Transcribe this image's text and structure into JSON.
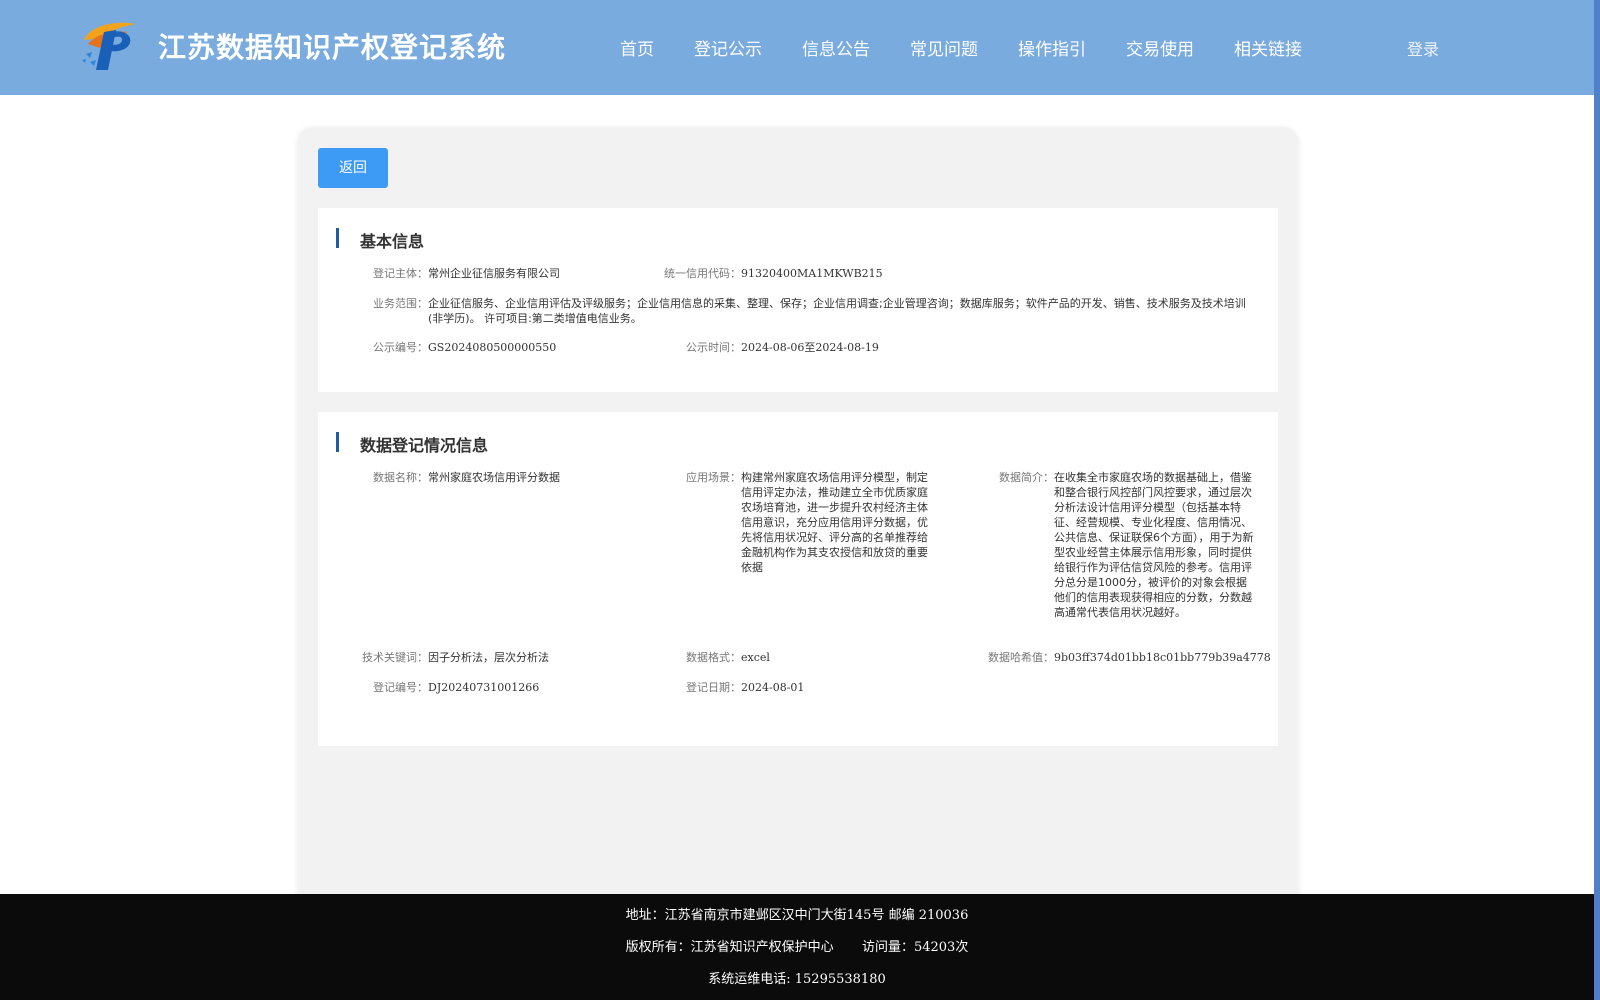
{
  "header": {
    "site_title": "江苏数据知识产权登记系统",
    "nav": [
      "首页",
      "登记公示",
      "信息公告",
      "常见问题",
      "操作指引",
      "交易使用",
      "相关链接"
    ],
    "login": "登录",
    "logo_icon": "ip-logo-icon"
  },
  "toolbar": {
    "back_label": "返回"
  },
  "basic": {
    "title": "基本信息",
    "subject_label": "登记主体：",
    "subject_value": "常州企业征信服务有限公司",
    "credit_code_label": "统一信用代码：",
    "credit_code_value": "91320400MA1MKWB215",
    "scope_label": "业务范围：",
    "scope_value": "企业征信服务、企业信用评估及评级服务；企业信用信息的采集、整理、保存；企业信用调查;企业管理咨询；数据库服务；软件产品的开发、销售、技术服务及技术培训(非学历)。 许可项目:第二类增值电信业务。",
    "pub_no_label": "公示编号：",
    "pub_no_value": "GS2024080500000550",
    "pub_time_label": "公示时间：",
    "pub_time_value": "2024-08-06至2024-08-19"
  },
  "data_reg": {
    "title": "数据登记情况信息",
    "name_label": "数据名称：",
    "name_value": "常州家庭农场信用评分数据",
    "scene_label": "应用场景：",
    "scene_value": "构建常州家庭农场信用评分模型，制定信用评定办法，推动建立全市优质家庭农场培育池，进一步提升农村经济主体信用意识，充分应用信用评分数据，优先将信用状况好、评分高的名单推荐给金融机构作为其支农授信和放贷的重要依据",
    "intro_label": "数据简介：",
    "intro_value": "在收集全市家庭农场的数据基础上，借鉴和整合银行风控部门风控要求，通过层次分析法设计信用评分模型（包括基本特征、经营规模、专业化程度、信用情况、公共信息、保证联保6个方面），用于为新型农业经营主体展示信用形象，同时提供给银行作为评估信贷风险的参考。信用评分总分是1000分，被评价的对象会根据他们的信用表现获得相应的分数，分数越高通常代表信用状况越好。",
    "keywords_label": "技术关键词：",
    "keywords_value": "因子分析法，层次分析法",
    "format_label": "数据格式：",
    "format_value": "excel",
    "hash_label": "数据哈希值：",
    "hash_value": "9b03ff374d01bb18c01bb779b39a4778",
    "reg_no_label": "登记编号：",
    "reg_no_value": "DJ20240731001266",
    "reg_date_label": "登记日期：",
    "reg_date_value": "2024-08-01"
  },
  "footer": {
    "address": "地址：江苏省南京市建邺区汉中门大街145号 邮编 210036",
    "copyright": "版权所有：江苏省知识产权保护中心",
    "visits": "访问量：54203次",
    "hotline": "系统运维电话: 15295538180"
  }
}
